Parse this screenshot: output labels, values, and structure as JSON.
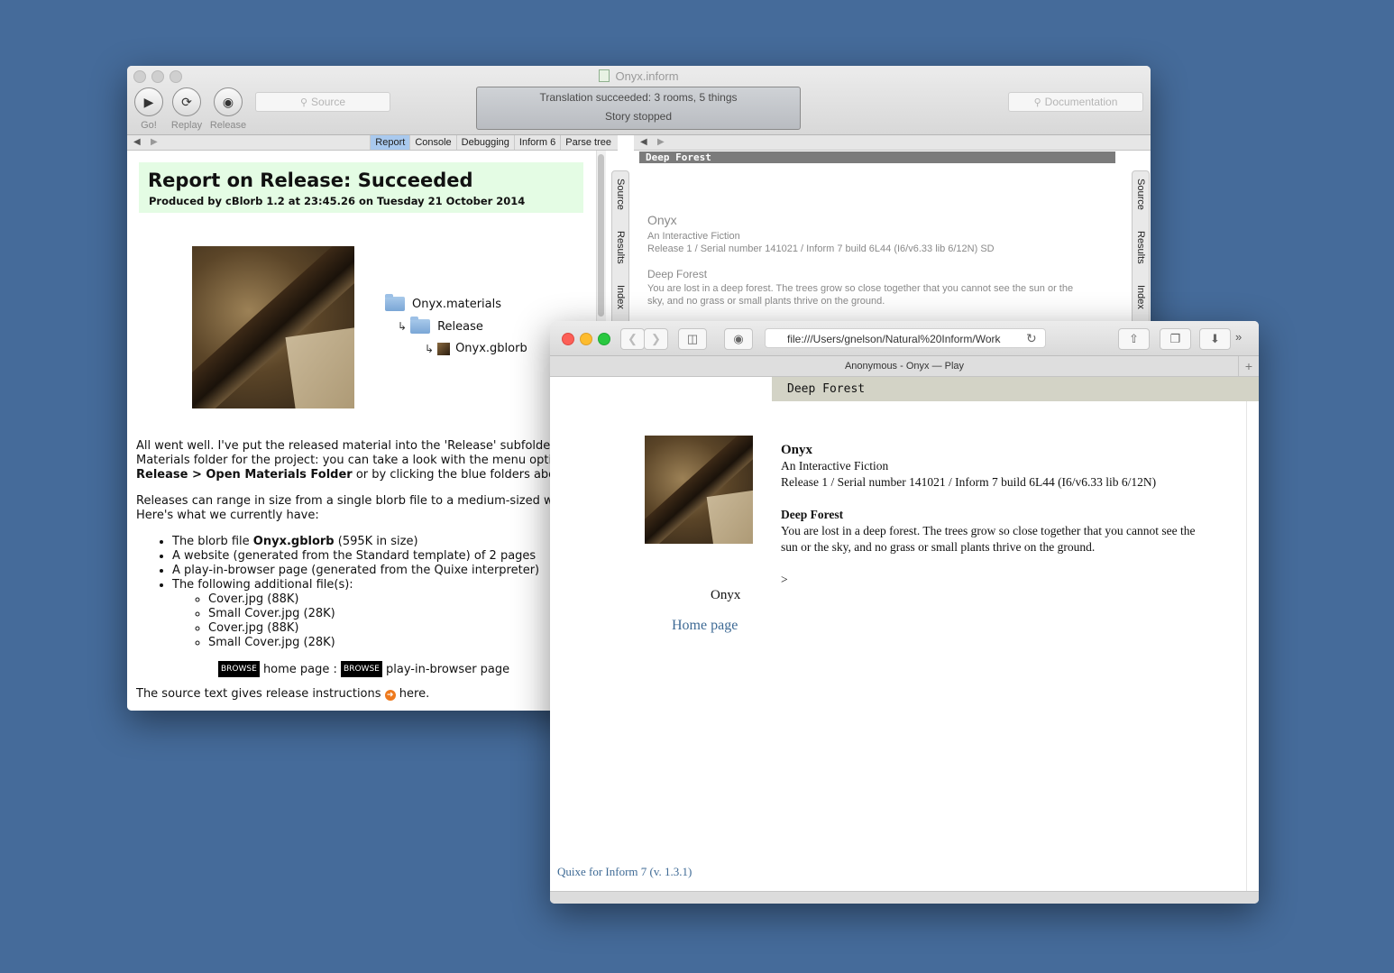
{
  "inform": {
    "title": "Onyx.inform",
    "toolbar": {
      "go": "Go!",
      "replay": "Replay",
      "release": "Release"
    },
    "source_search_placeholder": "Source",
    "documentation_search_placeholder": "Documentation",
    "status": {
      "line1": "Translation succeeded: 3 rooms, 5 things",
      "line2": "Story stopped"
    },
    "tabs": [
      "Report",
      "Console",
      "Debugging",
      "Inform 6",
      "Parse tree"
    ],
    "side_tabs": [
      "Source",
      "Results",
      "Index"
    ],
    "report": {
      "title": "Report on Release: Succeeded",
      "subtitle": "Produced by cBlorb 1.2 at 23:45.26 on Tuesday 21 October 2014",
      "tree": {
        "materials": "Onyx.materials",
        "release": "Release",
        "gblorb": "Onyx.gblorb"
      },
      "para1_line1": "All went well. I've put the released material into the 'Release' subfolder of",
      "para1_line2": "Materials folder for the project: you can take a look with the menu option",
      "para1_line3a": "Release > Open Materials Folder",
      "para1_line3b": " or by clicking the blue folders above.",
      "para2_line1": "Releases can range in size from a single blorb file to a medium-sized we",
      "para2_line2": "Here's what we currently have:",
      "list": {
        "item1a": "The blorb file ",
        "item1b": "Onyx.gblorb",
        "item1c": " (595K in size)",
        "item2": "A website (generated from the Standard template) of 2 pages",
        "item3": "A play-in-browser page (generated from the Quixe interpreter)",
        "item4": "The following additional file(s):",
        "files": [
          "Cover.jpg (88K)",
          "Small Cover.jpg (28K)",
          "Cover.jpg (88K)",
          "Small Cover.jpg (28K)"
        ]
      },
      "browse_badge": "BROWSE",
      "browse_home": " home page : ",
      "browse_play": " play-in-browser page",
      "source_text_a": "The source text gives release instructions ",
      "source_text_b": " here."
    },
    "results": {
      "status_bar": "Deep Forest",
      "title": "Onyx",
      "subtitle": "An Interactive Fiction",
      "release": "Release 1 / Serial number 141021 / Inform 7 build 6L44 (I6/v6.33 lib 6/12N) SD",
      "room": "Deep Forest",
      "desc1": "You are lost in a deep forest. The trees grow so close together that you cannot see the sun or the",
      "desc2": "sky, and no grass or small plants thrive on the ground."
    }
  },
  "safari": {
    "address": "file:///Users/gnelson/Natural%20Inform/Work",
    "tab_title": "Anonymous - Onyx — Play",
    "status_bar": "Deep Forest",
    "cover_caption": "Onyx",
    "home_link": "Home page",
    "game": {
      "title": "Onyx",
      "subtitle": "An Interactive Fiction",
      "release": "Release 1 / Serial number 141021 / Inform 7 build 6L44 (I6/v6.33 lib 6/12N)",
      "room": "Deep Forest",
      "desc1": "You are lost in a deep forest. The trees grow so close together that you cannot see the",
      "desc2": "sun or the sky, and no grass or small plants thrive on the ground.",
      "prompt": ">"
    },
    "footer_link": "Quixe for Inform 7 (v. 1.3.1)"
  },
  "colors": {
    "desktop": "#456b9a",
    "report_header": "#e4fce4",
    "link": "#3e6a95",
    "quixe_status": "#d3d3c6"
  }
}
